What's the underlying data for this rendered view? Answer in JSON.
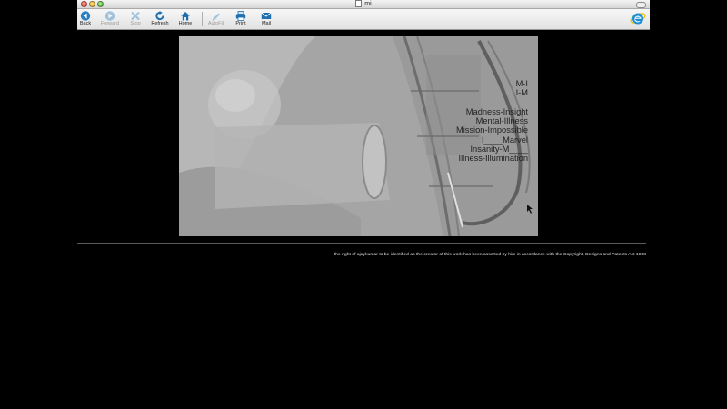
{
  "window": {
    "title": "mi"
  },
  "toolbar": {
    "back_label": "Back",
    "forward_label": "Forward",
    "stop_label": "Stop",
    "refresh_label": "Refresh",
    "home_label": "Home",
    "autofill_label": "AutoFill",
    "print_label": "Print",
    "mail_label": "Mail"
  },
  "image": {
    "lines": [
      "M-I",
      "I-M",
      "",
      "Madness-Insight",
      "Mental-Illness",
      "Mission-Impossible",
      "I____Marvel",
      "Insanity-M____",
      "Illness-Illumination"
    ]
  },
  "footer": {
    "copyright": "the right of ajaykumar to be identified as the creator of this work has been asserted by him in accordance with the Copyright, Designs and Patents Act 1988"
  },
  "colors": {
    "page_background": "#000000",
    "toolbar_icon": "#1f6fb0",
    "image_gray": "#a9a9a9"
  }
}
